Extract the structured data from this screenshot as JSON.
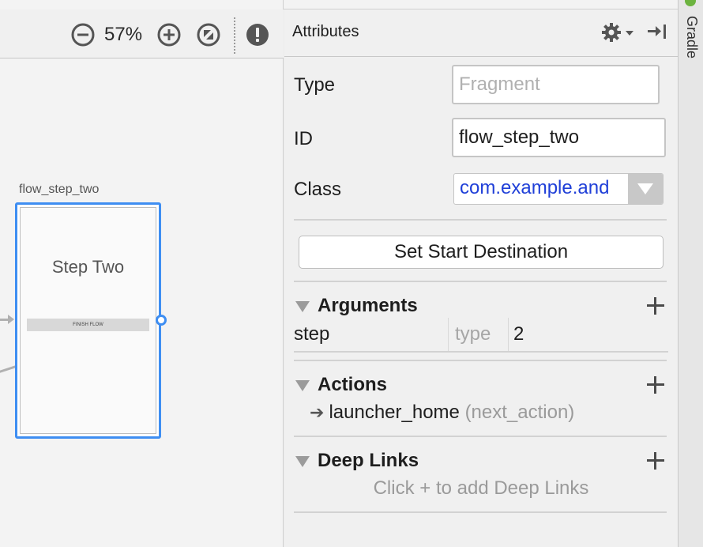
{
  "toolbar": {
    "zoom_level": "57%"
  },
  "canvas": {
    "fragment_id": "flow_step_two",
    "fragment_title": "Step Two",
    "fragment_button": "FINISH FLOW"
  },
  "attributes": {
    "title": "Attributes",
    "type_label": "Type",
    "type_value": "Fragment",
    "id_label": "ID",
    "id_value": "flow_step_two",
    "class_label": "Class",
    "class_value": "com.example.and",
    "start_button": "Set Start Destination"
  },
  "arguments": {
    "title": "Arguments",
    "rows": [
      {
        "name": "step",
        "type": "type",
        "value": "2"
      }
    ]
  },
  "actions": {
    "title": "Actions",
    "items": [
      {
        "destination": "launcher_home",
        "id": "(next_action)"
      }
    ]
  },
  "deep_links": {
    "title": "Deep Links",
    "hint": "Click + to add Deep Links"
  },
  "gutter": {
    "label": "Gradle"
  },
  "colors": {
    "selection": "#3e8ef2",
    "class_text": "#1f3fd8"
  }
}
